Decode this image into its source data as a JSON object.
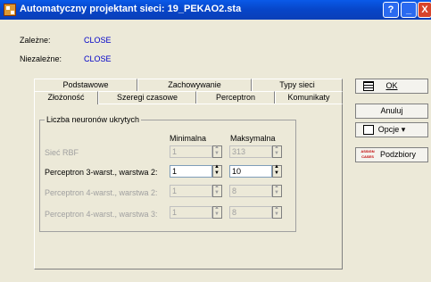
{
  "window": {
    "title": "Automatyczny projektant sieci: 19_PEKAO2.sta",
    "help_label": "?",
    "minimize_label": "_",
    "close_label": "X"
  },
  "info": {
    "dependent_label": "Zależne:",
    "dependent_value": "CLOSE",
    "independent_label": "Niezależne:",
    "independent_value": "CLOSE"
  },
  "tabs_back": [
    "Podstawowe",
    "Zachowywanie",
    "Typy sieci"
  ],
  "tabs_front": [
    "Złożoność",
    "Szeregi czasowe",
    "Perceptron",
    "Komunikaty"
  ],
  "group": {
    "title": "Liczba neuronów ukrytych",
    "col_min": "Minimalna",
    "col_max": "Maksymalna",
    "rows": [
      {
        "label": "Sieć RBF",
        "min": "1",
        "max": "313",
        "enabled": false
      },
      {
        "label": "Perceptron 3-warst., warstwa 2:",
        "min": "1",
        "max": "10",
        "enabled": true
      },
      {
        "label": "Perceptron 4-warst., warstwa 2:",
        "min": "1",
        "max": "8",
        "enabled": false
      },
      {
        "label": "Perceptron 4-warst., warstwa 3:",
        "min": "1",
        "max": "8",
        "enabled": false
      }
    ]
  },
  "buttons": {
    "ok": "OK",
    "cancel": "Anuluj",
    "options": "Opcje",
    "subsets": "Podzbiory",
    "subsets_icon_text": "ASSIGN CASES"
  }
}
